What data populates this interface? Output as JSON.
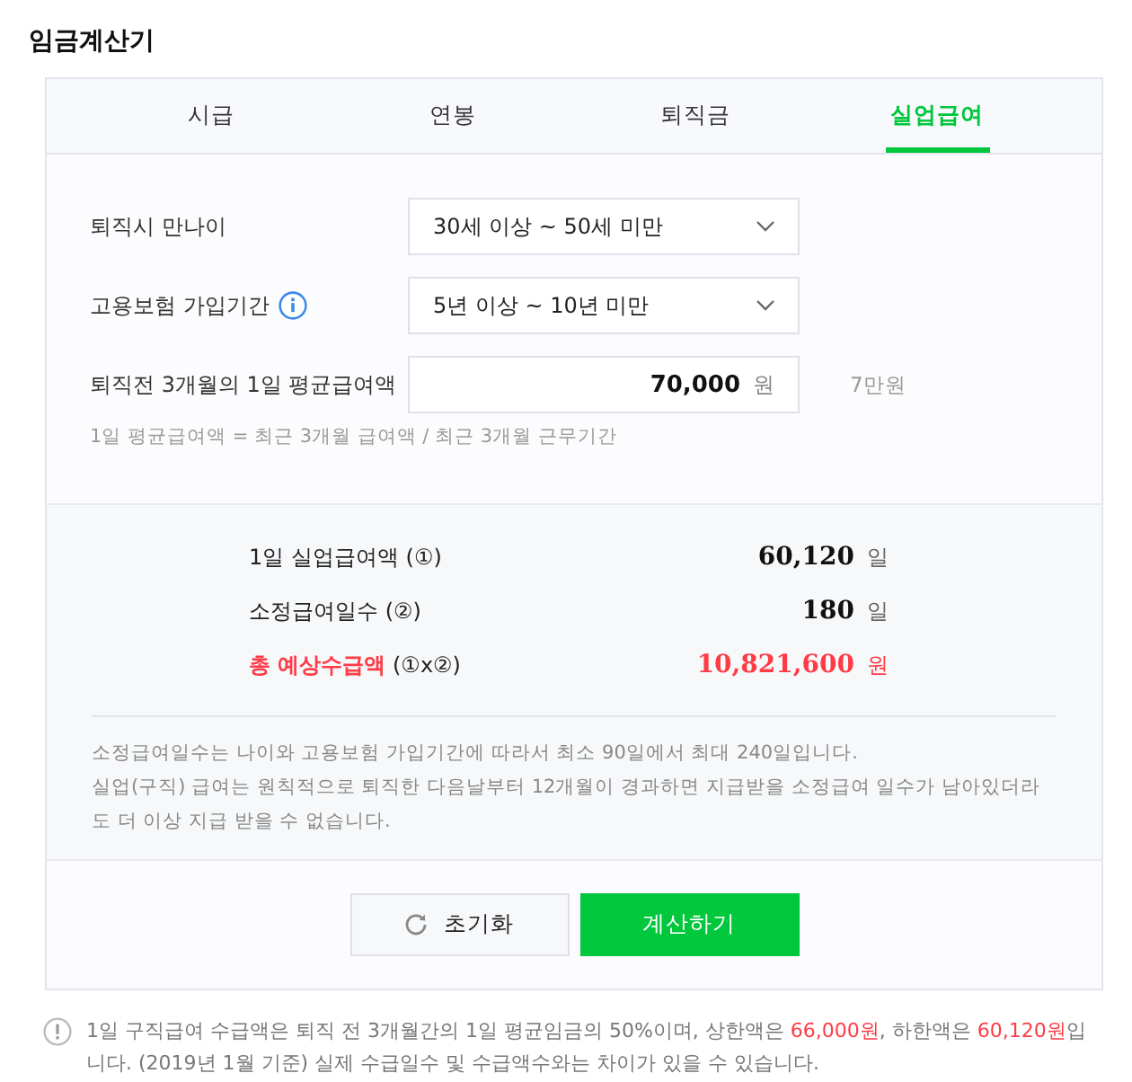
{
  "title": "임금계산기",
  "tabs": [
    {
      "label": "시급",
      "selected": false
    },
    {
      "label": "연봉",
      "selected": false
    },
    {
      "label": "퇴직금",
      "selected": false
    },
    {
      "label": "실업급여",
      "selected": true
    }
  ],
  "form": {
    "fields": [
      {
        "kind": "select",
        "label": "퇴직시 만나이",
        "info": false,
        "value": "30세 이상 ~ 50세 미만"
      },
      {
        "kind": "select",
        "label": "고용보험 가입기간",
        "info": true,
        "value": "5년 이상 ~ 10년 미만"
      },
      {
        "kind": "input",
        "label": "퇴직전 3개월의 1일 평균급여액",
        "info": false,
        "value": "70,000",
        "unit": "원",
        "hint": "7만원"
      }
    ],
    "formula": "1일 평균급여액 = 최근 3개월 급여액 / 최근 3개월 근무기간"
  },
  "results": {
    "rows": [
      {
        "kind": "normal",
        "label": "1일 실업급여액 (①)",
        "value": "60,120",
        "unit": "일"
      },
      {
        "kind": "normal",
        "label": "소정급여일수 (②)",
        "value": "180",
        "unit": "일"
      },
      {
        "kind": "total",
        "label": "**총 예상수급액** (①x②)",
        "value": "10,821,600",
        "unit": "원"
      }
    ],
    "notes": [
      "소정급여일수는 나이와 고용보험 가입기간에 따라서 최소 90일에서 최대 240일입니다.",
      "실업(구직) 급여는 원칙적으로 퇴직한 다음날부터 12개월이 경과하면 지급받을 소정급여 일수가 남아있더라도 더 이상 지급 받을 수 없습니다."
    ]
  },
  "buttons": [
    {
      "kind": "reset",
      "label": "초기화"
    },
    {
      "kind": "primary",
      "label": "계산하기"
    }
  ],
  "footnote": "1일 구직급여 수급액은 퇴직 전 3개월간의 1일 평균임금의 50%이며, 상한액은 **66,000원**, 하한액은 **60,120원**입니다. (2019년 1월 기준) 실제 수급일수 및 수급액수와는 차이가 있을 수 있습니다."
}
